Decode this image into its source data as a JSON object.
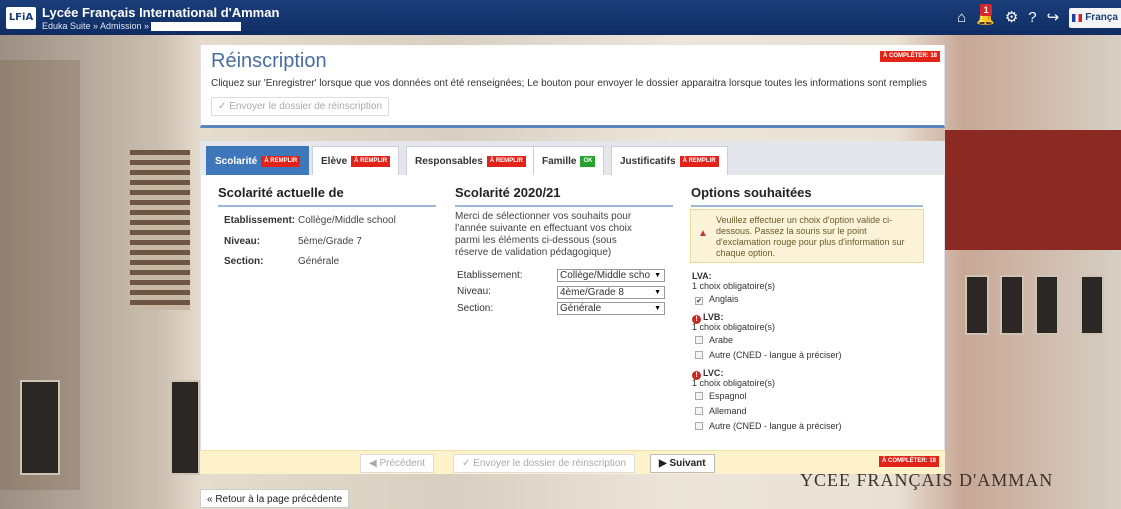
{
  "topbar": {
    "logo": "LFiA",
    "title": "Lycée Français International d'Amman",
    "breadcrumb": "Eduka Suite » Admission »",
    "notification_count": "1",
    "language": "França"
  },
  "header": {
    "title": "Réinscription",
    "badge": "À COMPLÉTER: 18",
    "subtitle": "Cliquez sur 'Enregistrer' lorsque que vos données ont été renseignées; Le bouton pour envoyer le dossier apparaitra lorsque toutes les informations sont remplies",
    "send_button": "Envoyer le dossier de réinscription"
  },
  "tabs": [
    {
      "label": "Scolarité",
      "badge": "À REMPLIR",
      "status": "red"
    },
    {
      "label": "Elève",
      "badge": "À REMPLIR",
      "status": "red"
    },
    {
      "label": "Responsables",
      "badge": "À REMPLIR",
      "status": "red"
    },
    {
      "label": "Famille",
      "badge": "OK",
      "status": "green"
    },
    {
      "label": "Justificatifs",
      "badge": "À REMPLIR",
      "status": "red"
    }
  ],
  "current": {
    "heading": "Scolarité actuelle de",
    "etab_label": "Etablissement:",
    "etab_value": "Collège/Middle school",
    "niveau_label": "Niveau:",
    "niveau_value": "5ème/Grade 7",
    "section_label": "Section:",
    "section_value": "Générale"
  },
  "next": {
    "heading": "Scolarité 2020/21",
    "intro": "Merci de sélectionner vos souhaits pour l'année suivante en effectuant vos choix parmi les éléments ci-dessous (sous réserve de validation pédagogique)",
    "etab_label": "Etablissement:",
    "etab_value": "Collège/Middle scho",
    "niveau_label": "Niveau:",
    "niveau_value": "4ème/Grade 8",
    "section_label": "Section:",
    "section_value": "Générale"
  },
  "options": {
    "heading": "Options souhaitées",
    "warning": "Veuillez effectuer un choix d'option valide ci-dessous. Passez la souris sur le point d'exclamation rouge pour plus d'information sur chaque option.",
    "lva_label": "LVA:",
    "lva_req": "1 choix obligatoire(s)",
    "lva_1": "Anglais",
    "lvb_label": "LVB:",
    "lvb_req": "1 choix obligatoire(s)",
    "lvb_1": "Arabe",
    "lvb_2": "Autre (CNED - langue à préciser)",
    "lvc_label": "LVC:",
    "lvc_req": "1 choix obligatoire(s)",
    "lvc_1": "Espagnol",
    "lvc_2": "Allemand",
    "lvc_3": "Autre (CNED - langue à préciser)"
  },
  "footer": {
    "prev": "Précédent",
    "send": "Envoyer le dossier de réinscription",
    "next": "Suivant",
    "badge": "À COMPLÉTER: 18"
  },
  "back_link": "« Retour à la page précédente",
  "background_sign": "YCEE FRANÇAIS D'AMMAN"
}
